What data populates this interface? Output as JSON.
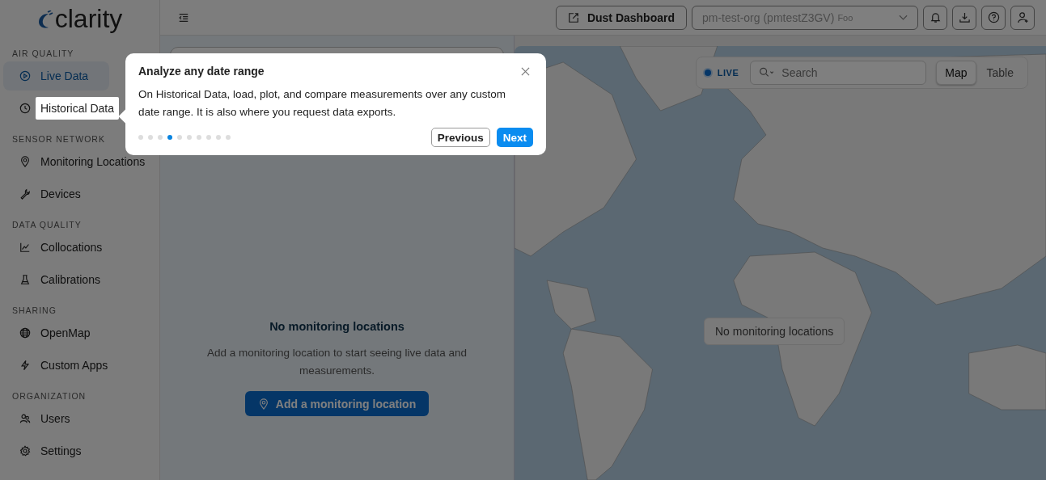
{
  "sidebar": {
    "logo": "clarity",
    "sections": [
      {
        "title": "AIR QUALITY",
        "items": [
          {
            "label": "Live Data",
            "selected": true,
            "highlighted": false
          },
          {
            "label": "Historical Data",
            "selected": false,
            "highlighted": true
          }
        ]
      },
      {
        "title": "SENSOR NETWORK",
        "items": [
          {
            "label": "Monitoring Locations",
            "selected": false,
            "highlighted": false
          },
          {
            "label": "Devices",
            "selected": false,
            "highlighted": false
          }
        ]
      },
      {
        "title": "DATA QUALITY",
        "items": [
          {
            "label": "Collocations",
            "selected": false,
            "highlighted": false
          },
          {
            "label": "Calibrations",
            "selected": false,
            "highlighted": false
          }
        ]
      },
      {
        "title": "SHARING",
        "items": [
          {
            "label": "OpenMap",
            "selected": false,
            "highlighted": false
          },
          {
            "label": "Custom Apps",
            "selected": false,
            "highlighted": false
          }
        ]
      },
      {
        "title": "ORGANIZATION",
        "items": [
          {
            "label": "Users",
            "selected": false,
            "highlighted": false
          },
          {
            "label": "Settings",
            "selected": false,
            "highlighted": false
          }
        ]
      }
    ]
  },
  "topbar": {
    "dashboard_button": "Dust Dashboard",
    "org_select": {
      "value": "pm-test-org (pmtestZ3GV)",
      "suffix": "Foo"
    }
  },
  "empty_state": {
    "title": "No monitoring locations",
    "text": "Add a monitoring location to start seeing live data and measurements.",
    "button": "Add a monitoring location"
  },
  "map": {
    "live": "LIVE",
    "search": {
      "placeholder": "Search"
    },
    "view_tabs": [
      {
        "label": "Map",
        "selected": true
      },
      {
        "label": "Table",
        "selected": false
      }
    ],
    "message": "No monitoring locations"
  },
  "tour": {
    "title": "Analyze any date range",
    "body": "On Historical Data, load, plot, and compare measurements over any custom date range. It is also where you request data exports.",
    "steps": [
      {
        "selected": false
      },
      {
        "selected": false
      },
      {
        "selected": false
      },
      {
        "selected": true
      },
      {
        "selected": false
      },
      {
        "selected": false
      },
      {
        "selected": false
      },
      {
        "selected": false
      },
      {
        "selected": false
      },
      {
        "selected": false
      }
    ],
    "previous": "Previous",
    "next": "Next"
  }
}
